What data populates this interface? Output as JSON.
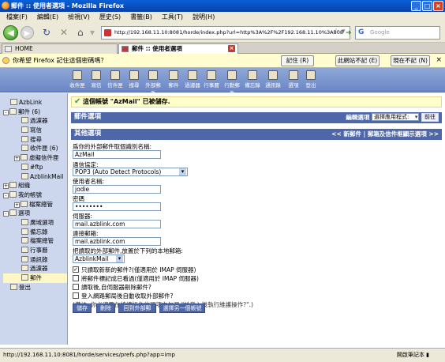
{
  "window": {
    "title": "郵件 :: 使用者選項 - Mozilla Firefox"
  },
  "menu": [
    "檔案(F)",
    "編輯(E)",
    "檢視(V)",
    "歷史(S)",
    "書籤(B)",
    "工具(T)",
    "說明(H)"
  ],
  "nav": {
    "url": "http://192.168.11.10:8081/horde/index.php?url=http%3A%2F%2F192.168.11.10%3A808",
    "search_placeholder": "Google"
  },
  "tabs": [
    {
      "label": "HOME"
    },
    {
      "label": "郵件 :: 使用者選項"
    }
  ],
  "notification": {
    "text": "你希望 Firefox 記住這個密碼嗎？",
    "buttons": [
      "記住 (R)",
      "此網站不記 (E)",
      "現在不記 (N)"
    ]
  },
  "horde_menu": [
    "收件匣",
    "寫信",
    "信件匣",
    "搜尋",
    "外部郵件",
    "郵件",
    "過濾器",
    "行事曆",
    "行動郵件",
    "備忘錄",
    "通訊錄",
    "選項",
    "登出"
  ],
  "sidebar": [
    {
      "label": "AzbLink",
      "indent": 0,
      "pm": ""
    },
    {
      "label": "郵件 (6)",
      "indent": 0,
      "pm": "-"
    },
    {
      "label": "過濾器",
      "indent": 1,
      "pm": ""
    },
    {
      "label": "寫信",
      "indent": 1,
      "pm": ""
    },
    {
      "label": "搜尋",
      "indent": 1,
      "pm": ""
    },
    {
      "label": "收件匣 (6)",
      "indent": 1,
      "pm": ""
    },
    {
      "label": "虛擬信件匣",
      "indent": 1,
      "pm": "+"
    },
    {
      "label": "#ftp",
      "indent": 1,
      "pm": ""
    },
    {
      "label": "AzblinkMail",
      "indent": 1,
      "pm": ""
    },
    {
      "label": "組織",
      "indent": 0,
      "pm": "+"
    },
    {
      "label": "我的帳號",
      "indent": 0,
      "pm": "-"
    },
    {
      "label": "檔案總管",
      "indent": 1,
      "pm": "+"
    },
    {
      "label": "選項",
      "indent": 0,
      "pm": "-"
    },
    {
      "label": "廣域選項",
      "indent": 1,
      "pm": ""
    },
    {
      "label": "備忘錄",
      "indent": 1,
      "pm": ""
    },
    {
      "label": "檔案總管",
      "indent": 1,
      "pm": ""
    },
    {
      "label": "行事曆",
      "indent": 1,
      "pm": ""
    },
    {
      "label": "通訊錄",
      "indent": 1,
      "pm": ""
    },
    {
      "label": "過濾器",
      "indent": 1,
      "pm": ""
    },
    {
      "label": "郵件",
      "indent": 1,
      "pm": "",
      "highlight": true
    },
    {
      "label": "登出",
      "indent": 0,
      "pm": ""
    }
  ],
  "main": {
    "saved_message": "這個帳號 \"AzMail\" 已被儲存.",
    "mail_options_title": "郵件選項",
    "edit_options_label": "編輯選項",
    "select_app": "選擇應用程式:",
    "go_label": "前往",
    "other_options_title": "其他選項",
    "header_links": "<< 新郵件 | 郵箱及信件框顯示選項 >>",
    "form": {
      "name_label": "爲你的外部郵件取個識別名稱:",
      "name_value": "AzMail",
      "protocol_label": "通信協定:",
      "protocol_value": "POP3 (Auto Detect Protocols)",
      "user_label": "使用者名稱:",
      "user_value": "jodie",
      "pass_label": "密碼",
      "pass_value": "••••••••",
      "server_label": "伺服器:",
      "server_value": "mail.azblink.com",
      "port_label": "連接郵箱:",
      "port_value": "mail.azblink.com",
      "folder_label": "把讀取的外部郵件,放置於下列的本地郵箱:",
      "folder_value": "AzblinkMail",
      "checks": [
        {
          "label": "只讀取新新的郵件?(僅適用於 IMAP 伺服器)",
          "checked": true
        },
        {
          "label": "將郵件標記成已看過(僅適用於 IMAP 伺服器)",
          "checked": false
        },
        {
          "label": "讀取後,自伺服器刪除郵件?",
          "checked": false
        },
        {
          "label": "登入網路郵局後自動收取外部郵件?",
          "checked": false
        }
      ],
      "note": "(備註: 你必須要在線讀操作的選項中勾選 \"於登入後執行維護操作?\".)"
    },
    "buttons": [
      "儲存",
      "刪除",
      "回到外部郵件",
      "選擇另一個帳號"
    ]
  },
  "status": {
    "left": "http://192.168.11.10:8081/horde/services/prefs.php?app=imp",
    "right": "開啟筆記本 ▮"
  }
}
